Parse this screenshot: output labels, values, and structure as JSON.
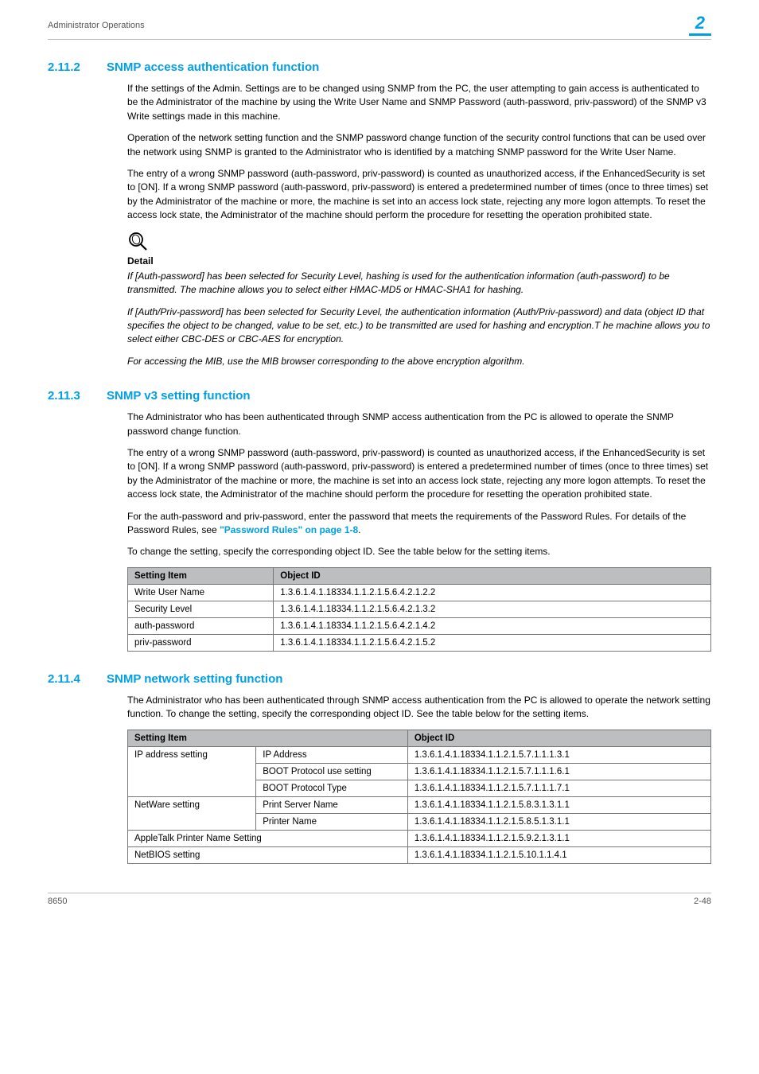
{
  "header": {
    "left": "Administrator Operations",
    "chapter": "2"
  },
  "footer": {
    "left": "8650",
    "right": "2-48"
  },
  "s2112": {
    "num": "2.11.2",
    "title": "SNMP access authentication function",
    "p1": "If the settings of the Admin. Settings are to be changed using SNMP from the PC, the user attempting to gain access is authenticated to be the Administrator of the machine by using the Write User Name and SNMP Password (auth-password, priv-password) of the SNMP v3 Write settings made in this machine.",
    "p2": "Operation of the network setting function and the SNMP password change function of the security control functions that can be used over the network using SNMP is granted to the Administrator who is identified by a matching SNMP password for the Write User Name.",
    "p3": "The entry of a wrong SNMP password (auth-password, priv-password) is counted as unauthorized access, if the EnhancedSecurity is set to [ON]. If a wrong SNMP password (auth-password, priv-password) is entered a predetermined number of times (once to three times) set by the Administrator of the machine or more, the machine is set into an access lock state, rejecting any more logon attempts. To reset the access lock state, the Administrator of the machine should perform the procedure for resetting the operation prohibited state."
  },
  "detail": {
    "label": "Detail",
    "p1": "If [Auth-password] has been selected for Security Level, hashing is used for the authentication information (auth-password) to be transmitted. The machine allows you to select either HMAC-MD5 or HMAC-SHA1 for hashing.",
    "p2": "If [Auth/Priv-password] has been selected for Security Level, the authentication information (Auth/Priv-password) and data (object ID that specifies the object to be changed, value to be set, etc.) to be transmitted are used for hashing and encryption.T he machine allows you to select either CBC-DES or CBC-AES for encryption.",
    "p3": "For accessing the MIB, use the MIB browser corresponding to the above encryption algorithm."
  },
  "s2113": {
    "num": "2.11.3",
    "title": "SNMP v3 setting function",
    "p1": "The Administrator who has been authenticated through SNMP access authentication from the PC is allowed to operate the SNMP password change function.",
    "p2": "The entry of a wrong SNMP password (auth-password, priv-password) is counted as unauthorized access, if the EnhancedSecurity is set to [ON]. If a wrong SNMP password (auth-password, priv-password) is entered a predetermined number of times (once to three times) set by the Administrator of the machine or more, the machine is set into an access lock state, rejecting any more logon attempts. To reset the access lock state, the Administrator of the machine should perform the procedure for resetting the operation prohibited state.",
    "p3_pre": "For the auth-password and priv-password, enter the password that meets the requirements of the Password Rules. For details of the Password Rules, see ",
    "p3_link": "\"Password Rules\" on page 1-8",
    "p3_post": ".",
    "p4": "To change the setting, specify the corresponding object ID. See the table below for the setting items.",
    "table": {
      "headers": [
        "Setting Item",
        "Object ID"
      ],
      "rows": [
        [
          "Write User Name",
          "1.3.6.1.4.1.18334.1.1.2.1.5.6.4.2.1.2.2"
        ],
        [
          "Security Level",
          "1.3.6.1.4.1.18334.1.1.2.1.5.6.4.2.1.3.2"
        ],
        [
          "auth-password",
          "1.3.6.1.4.1.18334.1.1.2.1.5.6.4.2.1.4.2"
        ],
        [
          "priv-password",
          "1.3.6.1.4.1.18334.1.1.2.1.5.6.4.2.1.5.2"
        ]
      ]
    }
  },
  "s2114": {
    "num": "2.11.4",
    "title": "SNMP network setting function",
    "p1": "The Administrator who has been authenticated through SNMP access authentication from the PC is allowed to operate the network setting function. To change the setting, specify the corresponding object ID. See the table below for the setting items.",
    "table": {
      "headers": [
        "Setting Item",
        "Object ID"
      ],
      "rows": [
        {
          "cat": "IP address setting",
          "sub": "IP Address",
          "oid": "1.3.6.1.4.1.18334.1.1.2.1.5.7.1.1.1.3.1",
          "rowspan": 3
        },
        {
          "sub": "BOOT Protocol use setting",
          "oid": "1.3.6.1.4.1.18334.1.1.2.1.5.7.1.1.1.6.1"
        },
        {
          "sub": "BOOT Protocol Type",
          "oid": "1.3.6.1.4.1.18334.1.1.2.1.5.7.1.1.1.7.1"
        },
        {
          "cat": "NetWare setting",
          "sub": "Print Server Name",
          "oid": "1.3.6.1.4.1.18334.1.1.2.1.5.8.3.1.3.1.1",
          "rowspan": 2
        },
        {
          "sub": "Printer Name",
          "oid": "1.3.6.1.4.1.18334.1.1.2.1.5.8.5.1.3.1.1"
        },
        {
          "span": true,
          "cat": "AppleTalk Printer Name Setting",
          "oid": "1.3.6.1.4.1.18334.1.1.2.1.5.9.2.1.3.1.1"
        },
        {
          "span": true,
          "cat": "NetBIOS setting",
          "oid": "1.3.6.1.4.1.18334.1.1.2.1.5.10.1.1.4.1"
        }
      ]
    }
  }
}
